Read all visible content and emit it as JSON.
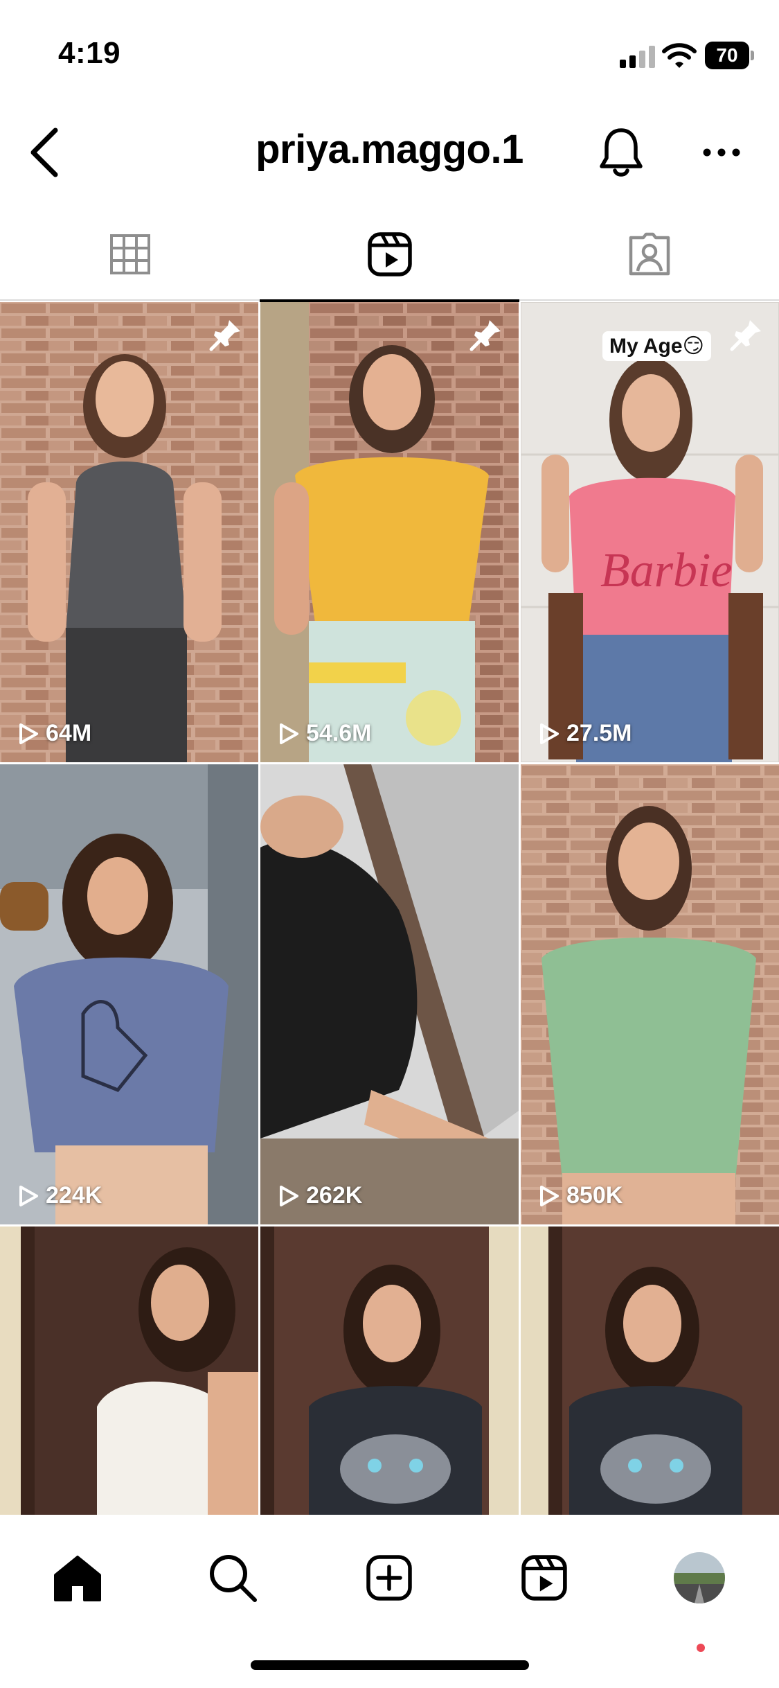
{
  "status_bar": {
    "time": "4:19",
    "battery_level": "70",
    "signal_icon": "cellular-signal-icon",
    "wifi_icon": "wifi-icon"
  },
  "header": {
    "username": "priya.maggo.1",
    "back_icon": "back-chevron-icon",
    "bell_icon": "bell-icon",
    "more_icon": "more-horizontal-icon"
  },
  "tabs": [
    {
      "icon": "grid-icon",
      "active": false
    },
    {
      "icon": "reels-icon",
      "active": true
    },
    {
      "icon": "tagged-icon",
      "active": false
    }
  ],
  "reels": [
    {
      "views": "64M",
      "pinned": true
    },
    {
      "views": "54.6M",
      "pinned": true
    },
    {
      "views": "27.5M",
      "pinned": true,
      "caption": "My Age😏"
    },
    {
      "views": "224K",
      "pinned": false
    },
    {
      "views": "262K",
      "pinned": false
    },
    {
      "views": "850K",
      "pinned": false
    },
    {
      "views": "",
      "pinned": false
    },
    {
      "views": "",
      "pinned": false
    },
    {
      "views": "",
      "pinned": false
    }
  ],
  "bottom_nav": [
    {
      "icon": "home-icon"
    },
    {
      "icon": "search-icon"
    },
    {
      "icon": "create-icon"
    },
    {
      "icon": "reels-icon"
    },
    {
      "icon": "profile-avatar"
    }
  ],
  "colors": {
    "notification_dot": "#ed4956",
    "divider": "#dbdbdb",
    "tab_icon_inactive": "#8e8e8e"
  }
}
